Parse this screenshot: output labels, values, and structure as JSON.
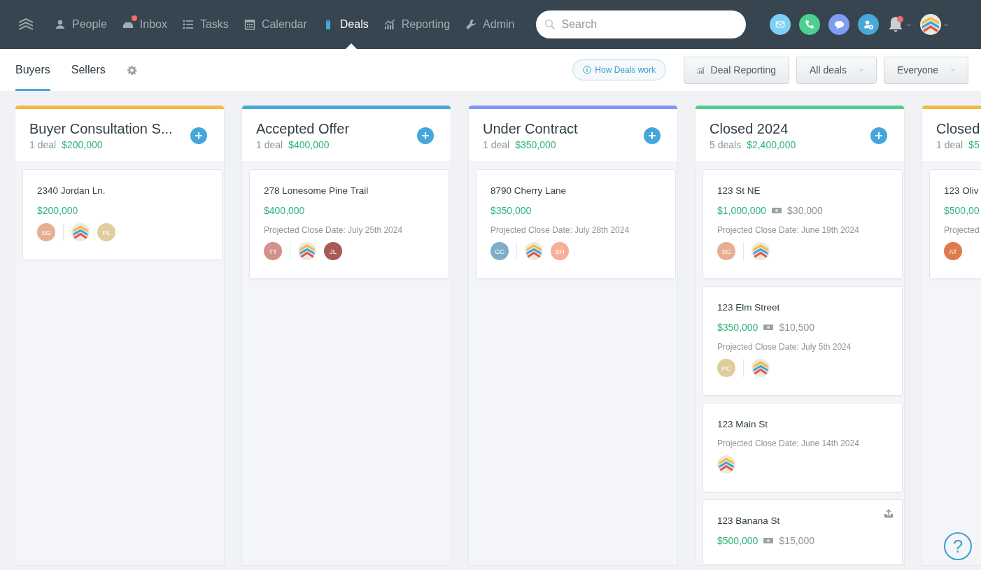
{
  "nav": {
    "items": [
      {
        "label": "People",
        "selected": false,
        "badge": false
      },
      {
        "label": "Inbox",
        "selected": false,
        "badge": true
      },
      {
        "label": "Tasks",
        "selected": false,
        "badge": false
      },
      {
        "label": "Calendar",
        "selected": false,
        "badge": false
      },
      {
        "label": "Deals",
        "selected": true,
        "badge": false
      },
      {
        "label": "Reporting",
        "selected": false,
        "badge": false
      },
      {
        "label": "Admin",
        "selected": false,
        "badge": false
      }
    ],
    "search": {
      "placeholder": "Search"
    },
    "actions": [
      {
        "kind": "mail",
        "color": "#7fd0f7"
      },
      {
        "kind": "phone",
        "color": "#4cd08f"
      },
      {
        "kind": "chat",
        "color": "#7f9cf5"
      },
      {
        "kind": "add-contact",
        "color": "#4aa8d8"
      }
    ],
    "notifications": {
      "badge": true
    }
  },
  "tabs": [
    {
      "label": "Buyers",
      "selected": true
    },
    {
      "label": "Sellers",
      "selected": false
    }
  ],
  "toolbar": {
    "help_link": "How Deals work",
    "report_button": "Deal Reporting",
    "filters": [
      {
        "label": "All deals"
      },
      {
        "label": "Everyone"
      }
    ]
  },
  "columns": [
    {
      "title": "Buyer Consultation S...",
      "count": "1 deal",
      "amount": "$200,000",
      "color": "#f5b942",
      "cards": [
        {
          "address": "2340 Jordan Ln.",
          "price": "$200,000",
          "upload_icon": false,
          "avatars": [
            {
              "kind": "initials",
              "initials": "SG",
              "color": "#e8ae92"
            },
            {
              "kind": "logo"
            },
            {
              "kind": "initials",
              "initials": "PL",
              "color": "#e2cd9e"
            }
          ]
        }
      ]
    },
    {
      "title": "Accepted Offer",
      "count": "1 deal",
      "amount": "$400,000",
      "color": "#4aa8d8",
      "cards": [
        {
          "address": "278 Lonesome Pine Trail",
          "price": "$400,000",
          "close_date": "Projected Close Date: July 25th 2024",
          "upload_icon": false,
          "avatars": [
            {
              "kind": "initials",
              "initials": "TT",
              "color": "#d3918a"
            },
            {
              "kind": "logo"
            },
            {
              "kind": "initials",
              "initials": "JL",
              "color": "#a85a58"
            }
          ]
        }
      ]
    },
    {
      "title": "Under Contract",
      "count": "1 deal",
      "amount": "$350,000",
      "color": "#7f96f7",
      "cards": [
        {
          "address": "8790 Cherry Lane",
          "price": "$350,000",
          "close_date": "Projected Close Date: July 28th 2024",
          "upload_icon": false,
          "avatars": [
            {
              "kind": "initials",
              "initials": "GC",
              "color": "#7fadc9"
            },
            {
              "kind": "logo"
            },
            {
              "kind": "initials",
              "initials": "BH",
              "color": "#f9ae98"
            }
          ]
        }
      ]
    },
    {
      "title": "Closed 2024",
      "count": "5 deals",
      "amount": "$2,400,000",
      "color": "#4cd08f",
      "cards": [
        {
          "address": "123 St NE",
          "price": "$1,000,000",
          "commission": "$30,000",
          "close_date": "Projected Close Date: June 19th 2024",
          "upload_icon": false,
          "avatars": [
            {
              "kind": "initials",
              "initials": "SG",
              "color": "#e8ae92"
            },
            {
              "kind": "logo"
            }
          ]
        },
        {
          "address": "123 Elm Street",
          "price": "$350,000",
          "commission": "$10,500",
          "close_date": "Projected Close Date: July 5th 2024",
          "upload_icon": false,
          "avatars": [
            {
              "kind": "initials",
              "initials": "PC",
              "color": "#e0cb9c"
            },
            {
              "kind": "logo"
            }
          ]
        },
        {
          "address": "123 Main St",
          "close_date": "Projected Close Date: June 14th 2024",
          "upload_icon": false,
          "avatars": [
            {
              "kind": "logo"
            }
          ]
        },
        {
          "address": "123 Banana St",
          "price": "$500,000",
          "commission": "$15,000",
          "upload_icon": true
        }
      ]
    },
    {
      "title": "Closed",
      "count": "1 deal",
      "amount": "$5",
      "color": "#f5b942",
      "cards": [
        {
          "address": "123 Oliv",
          "price": "$500,00",
          "close_date": "Projected",
          "avatars": [
            {
              "kind": "initials",
              "initials": "AT",
              "color": "#e07a4c"
            }
          ]
        }
      ]
    }
  ],
  "help": {
    "label": "?"
  }
}
